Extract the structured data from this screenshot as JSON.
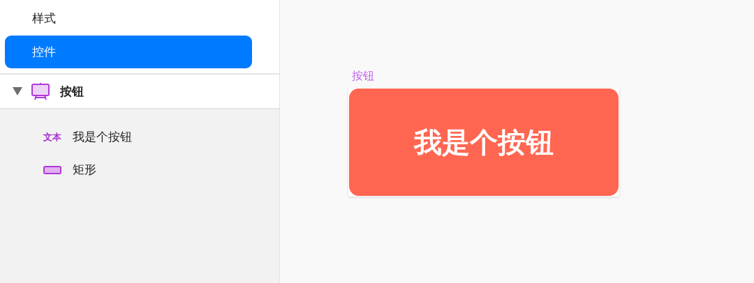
{
  "pages": [
    {
      "label": "样式",
      "selected": false
    },
    {
      "label": "控件",
      "selected": true
    }
  ],
  "layer_group": {
    "name": "按钮",
    "expanded": true,
    "children": [
      {
        "kind": "text",
        "badge": "文本",
        "name": "我是个按钮"
      },
      {
        "kind": "rect",
        "name": "矩形"
      }
    ]
  },
  "canvas": {
    "artboard_label": "按钮",
    "button_text": "我是个按钮"
  }
}
